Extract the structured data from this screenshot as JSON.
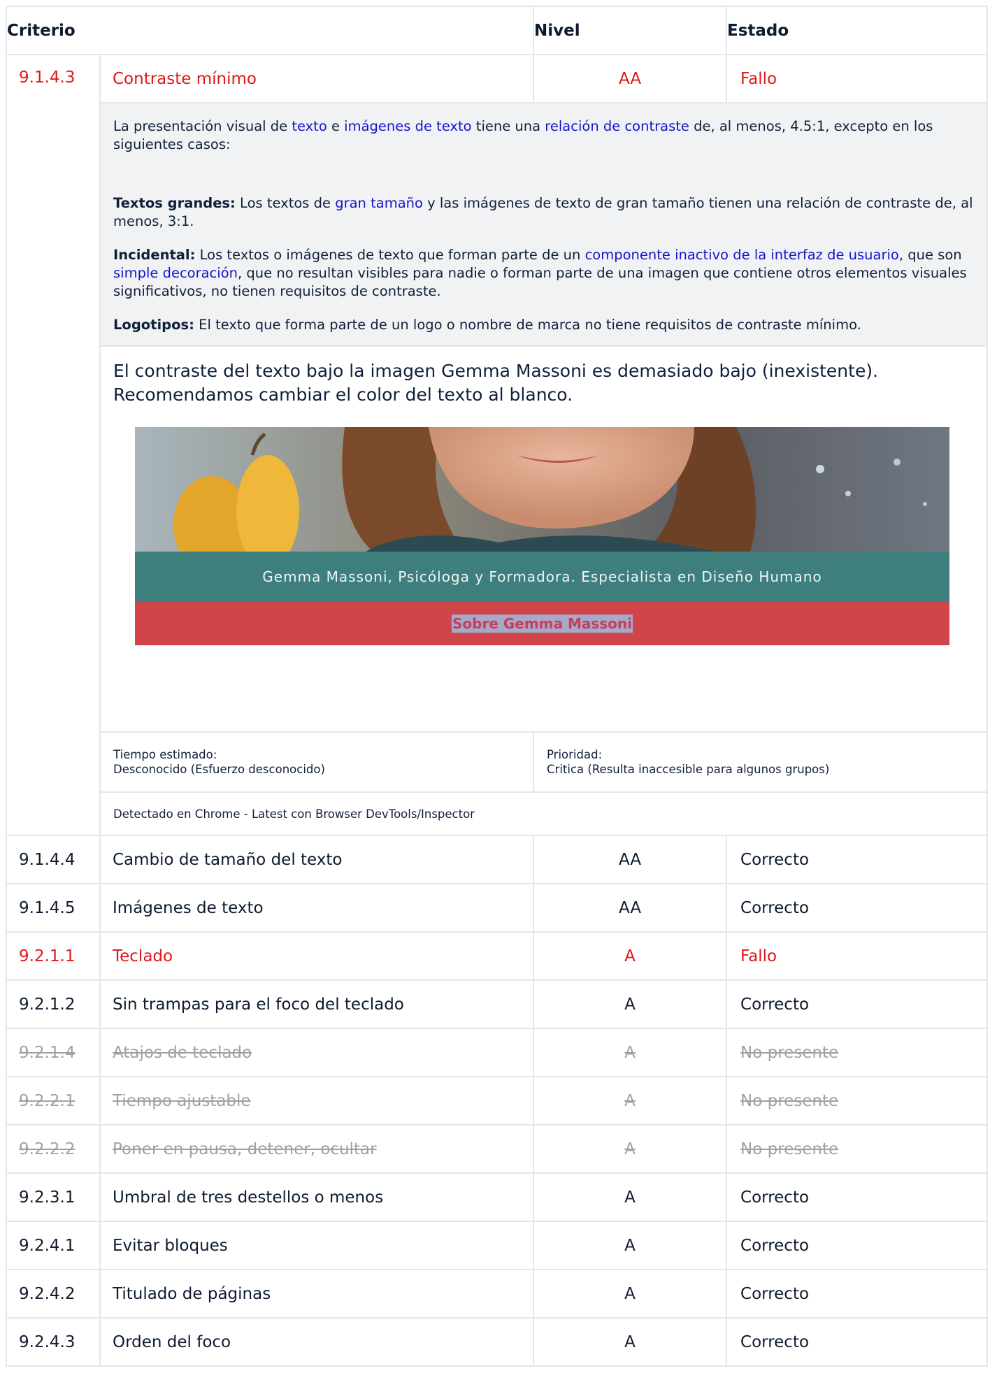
{
  "header": {
    "criterio": "Criterio",
    "nivel": "Nivel",
    "estado": "Estado"
  },
  "failing": {
    "id": "9.1.4.3",
    "name": "Contraste mínimo",
    "level": "AA",
    "status": "Fallo",
    "desc": {
      "p1_a": "La presentación visual de ",
      "p1_link1": "texto",
      "p1_b": " e ",
      "p1_link2": "imágenes de texto",
      "p1_c": " tiene una ",
      "p1_link3": "relación de contraste",
      "p1_d": " de, al menos, 4.5:1, excepto en los siguientes casos:",
      "p2_bold": "Textos grandes:",
      "p2_a": " Los textos de ",
      "p2_link": "gran tamaño",
      "p2_b": " y las imágenes de texto de gran tamaño tienen una relación de contraste de, al menos, 3:1.",
      "p3_bold": "Incidental:",
      "p3_a": " Los textos o imágenes de texto que forman parte de un ",
      "p3_link1": "componente inactivo de la interfaz de usuario",
      "p3_b": ", que son ",
      "p3_link2": "simple decoración",
      "p3_c": ", que no resultan visibles para nadie o forman parte de una imagen que contiene otros elementos visuales significativos, no tienen requisitos de contraste.",
      "p4_bold": "Logotipos:",
      "p4_a": " El texto que forma parte de un logo o nombre de marca no tiene requisitos de contraste mínimo."
    },
    "note": "El contraste del texto bajo la imagen Gemma Massoni es demasiado bajo (inexistente). Recomendamos cambiar el color del texto al blanco.",
    "screenshot": {
      "caption": "Gemma Massoni, Psicóloga y Formadora. Especialista en Diseño Humano",
      "button": "Sobre Gemma Massoni",
      "teal_color": "#3e7f7e",
      "red_color": "#cf4549"
    },
    "time_label": "Tiempo estimado:",
    "time_value": "Desconocido (Esfuerzo desconocido)",
    "priority_label": "Prioridad:",
    "priority_value": "Critica (Resulta inaccesible para algunos grupos)",
    "detected": "Detectado en Chrome - Latest con Browser DevTools/Inspector"
  },
  "rows": [
    {
      "id": "9.1.4.4",
      "name": "Cambio de tamaño del texto",
      "level": "AA",
      "status": "Correcto",
      "state": "ok"
    },
    {
      "id": "9.1.4.5",
      "name": "Imágenes de texto",
      "level": "AA",
      "status": "Correcto",
      "state": "ok"
    },
    {
      "id": "9.2.1.1",
      "name": "Teclado",
      "level": "A",
      "status": "Fallo",
      "state": "fail"
    },
    {
      "id": "9.2.1.2",
      "name": "Sin trampas para el foco del teclado",
      "level": "A",
      "status": "Correcto",
      "state": "ok"
    },
    {
      "id": "9.2.1.4",
      "name": "Atajos de teclado",
      "level": "A",
      "status": "No presente",
      "state": "na"
    },
    {
      "id": "9.2.2.1",
      "name": "Tiempo ajustable",
      "level": "A",
      "status": "No presente",
      "state": "na"
    },
    {
      "id": "9.2.2.2",
      "name": "Poner en pausa, detener, ocultar",
      "level": "A",
      "status": "No presente",
      "state": "na"
    },
    {
      "id": "9.2.3.1",
      "name": "Umbral de tres destellos o menos",
      "level": "A",
      "status": "Correcto",
      "state": "ok"
    },
    {
      "id": "9.2.4.1",
      "name": "Evitar bloques",
      "level": "A",
      "status": "Correcto",
      "state": "ok"
    },
    {
      "id": "9.2.4.2",
      "name": "Titulado de páginas",
      "level": "A",
      "status": "Correcto",
      "state": "ok"
    },
    {
      "id": "9.2.4.3",
      "name": "Orden del foco",
      "level": "A",
      "status": "Correcto",
      "state": "ok"
    }
  ],
  "colors": {
    "fail": "#e01818",
    "link": "#1414cc",
    "not_present": "#9ea2a6",
    "detail_bg": "#f1f2f4"
  }
}
